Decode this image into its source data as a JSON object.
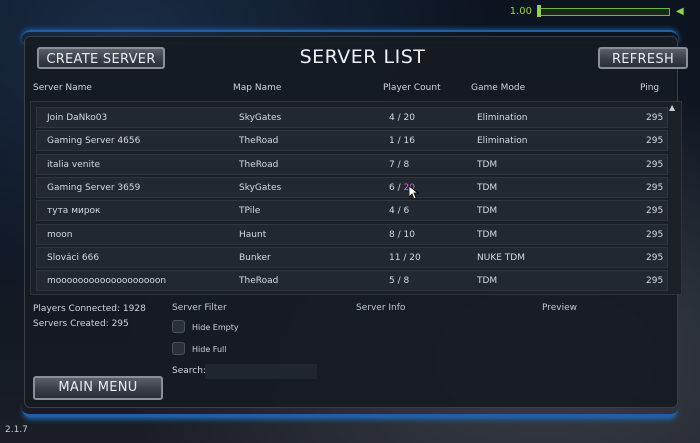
{
  "volume": {
    "value": "1.00",
    "level": 0.0
  },
  "header": {
    "title": "SERVER LIST",
    "create_label": "CREATE SERVER",
    "refresh_label": "REFRESH"
  },
  "columns": {
    "name": "Server Name",
    "map": "Map Name",
    "players": "Player Count",
    "mode": "Game Mode",
    "ping": "Ping"
  },
  "servers": [
    {
      "name": "Join DaNko03",
      "map": "SkyGates",
      "count": "4",
      "max": "20",
      "mode": "Elimination",
      "ping": "295"
    },
    {
      "name": "Gaming Server 4656",
      "map": "TheRoad",
      "count": "1",
      "max": "16",
      "mode": "Elimination",
      "ping": "295"
    },
    {
      "name": "italia venite",
      "map": "TheRoad",
      "count": "7",
      "max": "8",
      "mode": "TDM",
      "ping": "295"
    },
    {
      "name": "Gaming Server 3659",
      "map": "SkyGates",
      "count": "6",
      "max": "20",
      "mode": "TDM",
      "ping": "295"
    },
    {
      "name": "тута мирок",
      "map": "TPile",
      "count": "4",
      "max": "6",
      "mode": "TDM",
      "ping": "295"
    },
    {
      "name": "moon",
      "map": "Haunt",
      "count": "8",
      "max": "10",
      "mode": "TDM",
      "ping": "295"
    },
    {
      "name": "Slováci 666",
      "map": "Bunker",
      "count": "11",
      "max": "20",
      "mode": "NUKE TDM",
      "ping": "295"
    },
    {
      "name": "mooooooooooooooooooon",
      "map": "TheRoad",
      "count": "5",
      "max": "8",
      "mode": "TDM",
      "ping": "295"
    }
  ],
  "highlight_color": "#c46fd6",
  "stats": {
    "players_connected": "Players Connected: 1928",
    "servers_created": "Servers Created: 295"
  },
  "filter": {
    "title": "Server Filter",
    "hide_empty": "Hide Empty",
    "hide_full": "Hide Full",
    "search_label": "Search:",
    "search_value": ""
  },
  "server_info_label": "Server Info",
  "preview_label": "Preview",
  "main_menu_label": "MAIN MENU",
  "version": "2.1.7"
}
